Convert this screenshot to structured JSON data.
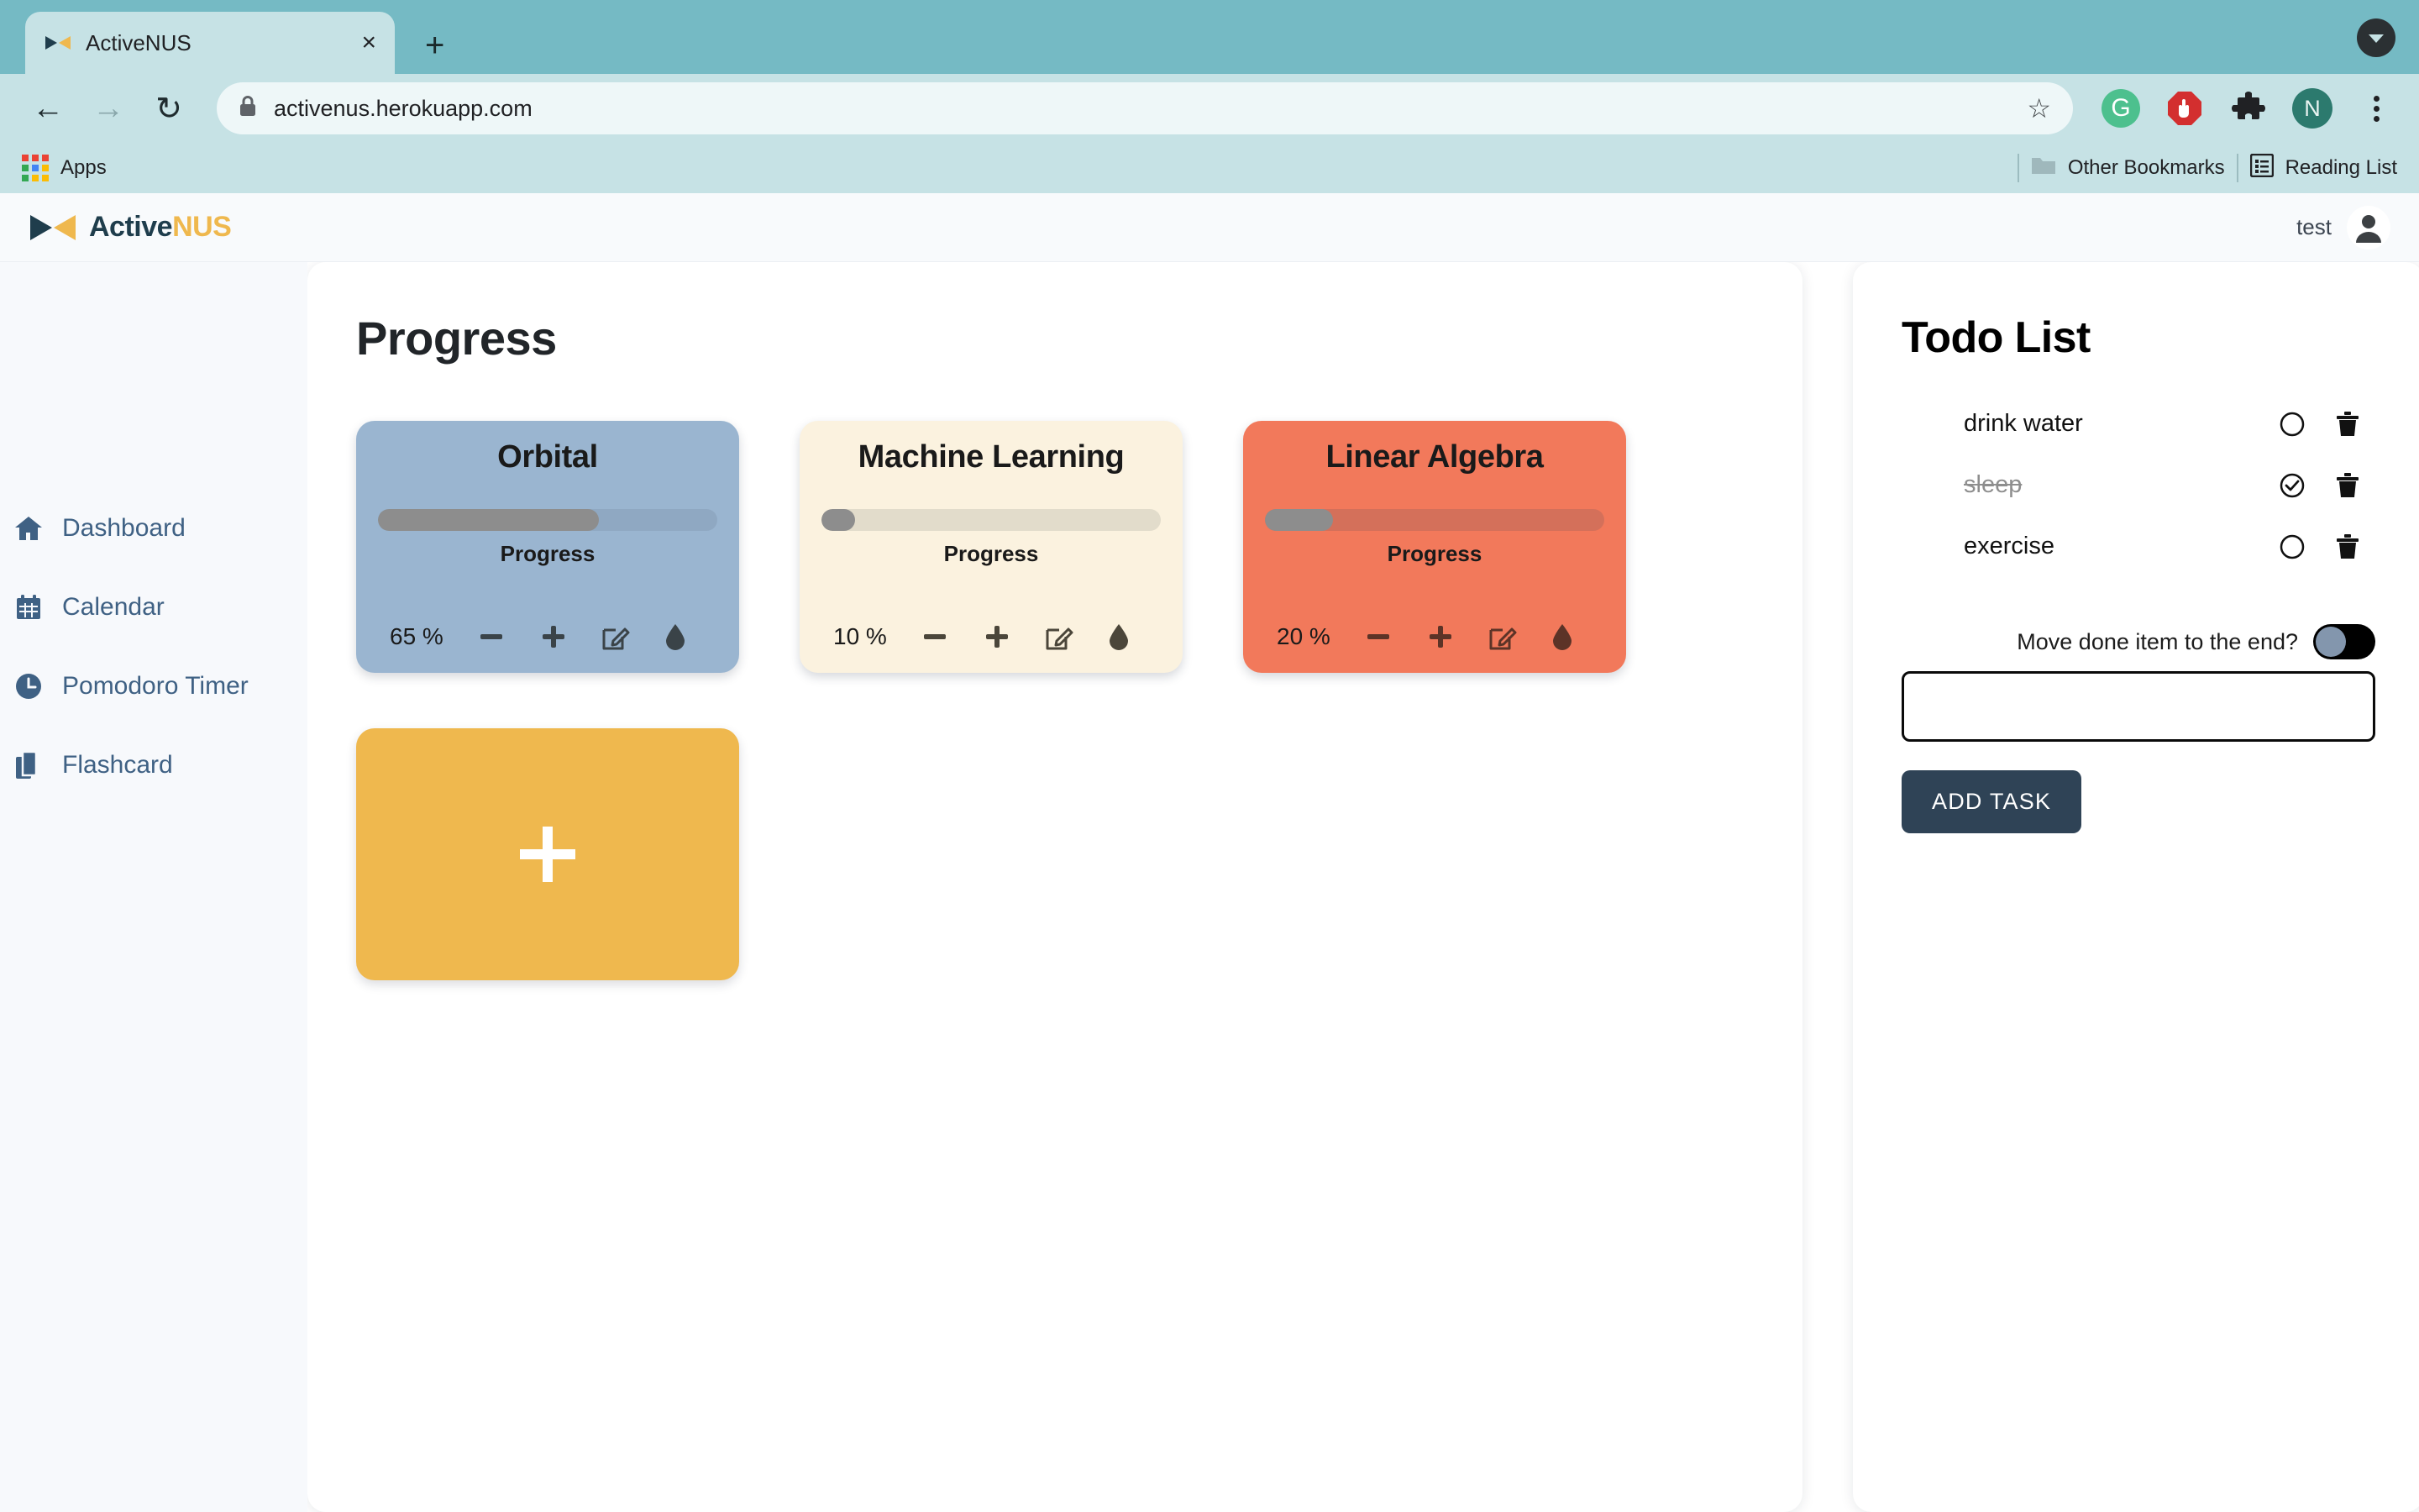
{
  "browser": {
    "tab": {
      "title": "ActiveNUS",
      "close_label": "×",
      "favicon": "activenus-favicon"
    },
    "new_tab_label": "+",
    "tab_list_icon": "tab-search-chevron-icon",
    "nav": {
      "back": "←",
      "forward": "→",
      "reload": "↻"
    },
    "omnibox": {
      "url": "activenus.herokuapp.com",
      "lock_icon": "lock-icon",
      "star_icon": "star-icon"
    },
    "extensions": [
      {
        "name": "grammarly-extension",
        "glyph": "G"
      },
      {
        "name": "adblock-extension",
        "glyph": "✋"
      },
      {
        "name": "extensions-puzzle-icon",
        "glyph": "puzzle"
      },
      {
        "name": "profile-avatar",
        "glyph": "N"
      },
      {
        "name": "chrome-menu-icon",
        "glyph": "⋮"
      }
    ],
    "bookmarks": {
      "apps_label": "Apps",
      "other_bookmarks_label": "Other Bookmarks",
      "reading_list_label": "Reading List"
    }
  },
  "app": {
    "logo": {
      "active": "Active",
      "nus": "NUS"
    },
    "user": {
      "name": "test",
      "avatar_icon": "user-avatar-icon"
    },
    "sidebar": {
      "items": [
        {
          "label": "Dashboard",
          "icon": "home-icon"
        },
        {
          "label": "Calendar",
          "icon": "calendar-icon"
        },
        {
          "label": "Pomodoro Timer",
          "icon": "clock-icon"
        },
        {
          "label": "Flashcard",
          "icon": "copy-pages-icon"
        }
      ]
    },
    "progress": {
      "title": "Progress",
      "progress_label": "Progress",
      "add_card_label": "+",
      "actions": {
        "decrement": "minus-icon",
        "increment": "plus-icon",
        "edit": "edit-pencil-square-icon",
        "water": "water-droplet-icon"
      },
      "cards": [
        {
          "title": "Orbital",
          "percent": 65,
          "percent_label": "65 %",
          "bg": "#9AB5D0",
          "track": "#8FA8C2",
          "fill": "#8D8D8D"
        },
        {
          "title": "Machine Learning",
          "percent": 10,
          "percent_label": "10 %",
          "bg": "#FBF2DF",
          "track": "#E2DCCB",
          "fill": "#8D8D8D"
        },
        {
          "title": "Linear Algebra",
          "percent": 20,
          "percent_label": "20 %",
          "bg": "#F2795B",
          "track": "#D4705A",
          "fill": "#8D8D8D"
        }
      ]
    },
    "todo": {
      "title": "Todo List",
      "items": [
        {
          "text": "drink water",
          "done": false,
          "check_icon": "circle-icon",
          "delete_icon": "trash-icon"
        },
        {
          "text": "sleep",
          "done": true,
          "check_icon": "check-circle-icon",
          "delete_icon": "trash-icon"
        },
        {
          "text": "exercise",
          "done": false,
          "check_icon": "circle-icon",
          "delete_icon": "trash-icon"
        }
      ],
      "toggle_label": "Move done item to the end?",
      "toggle_on": false,
      "input_value": "",
      "input_placeholder": "",
      "add_button_label": "ADD TASK"
    }
  }
}
